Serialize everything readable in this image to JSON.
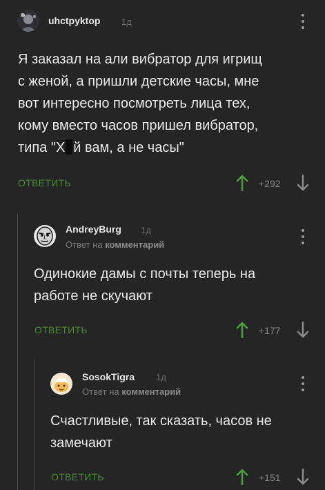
{
  "comments": [
    {
      "username": "uhctpyktop",
      "time": "1д",
      "text_lines": [
        "Я заказал на али вибратор для игрищ",
        "с женой, а пришли детские часы, мне",
        "вот интересно посмотреть лица тех,",
        "кому вместо часов пришел вибратор,"
      ],
      "text_last_before": "типа \"Х",
      "text_last_after": "й вам, а не часы\"",
      "reply_label": "ОТВЕТИТЬ",
      "score": "+292"
    },
    {
      "username": "AndreyBurg",
      "time": "1д",
      "reply_prefix": "Ответ на",
      "reply_target": "комментарий",
      "text_lines": [
        "Одинокие дамы с почты теперь на",
        "работе не скучают"
      ],
      "reply_label": "ОТВЕТИТЬ",
      "score": "+177"
    },
    {
      "username": "SosokTigra",
      "time": "1д",
      "reply_prefix": "Ответ на",
      "reply_target": "комментарий",
      "text_lines": [
        "Счастливые, так сказать, часов не",
        "замечают"
      ],
      "reply_label": "ОТВЕТИТЬ",
      "score": "+151"
    }
  ],
  "colors": {
    "background": "#252525",
    "reply_green": "#4a8a36",
    "score_grey": "#8a8a8a"
  },
  "icons": [
    "avatar",
    "more-vertical-icon",
    "upvote-arrow-icon",
    "downvote-arrow-icon"
  ]
}
